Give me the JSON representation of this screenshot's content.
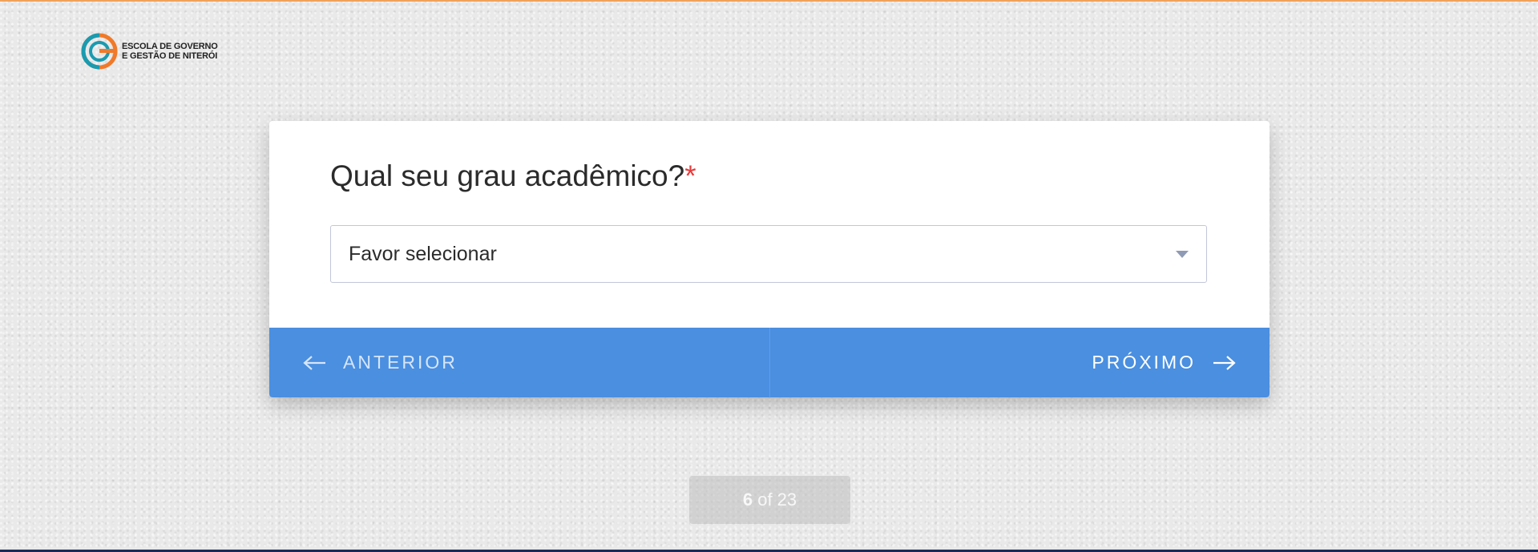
{
  "brand": {
    "line1": "ESCOLA DE GOVERNO",
    "line2": "E GESTÃO DE NITERÓI",
    "colors": {
      "teal": "#1a9bb0",
      "orange": "#f07a2a"
    }
  },
  "question": {
    "text": "Qual seu grau acadêmico?",
    "required_marker": "*"
  },
  "select": {
    "value": "Favor selecionar"
  },
  "nav": {
    "prev_label": "ANTERIOR",
    "next_label": "PRÓXIMO",
    "color": "#4a8fe0"
  },
  "progress": {
    "current": "6",
    "separator": " of ",
    "total": "23"
  }
}
